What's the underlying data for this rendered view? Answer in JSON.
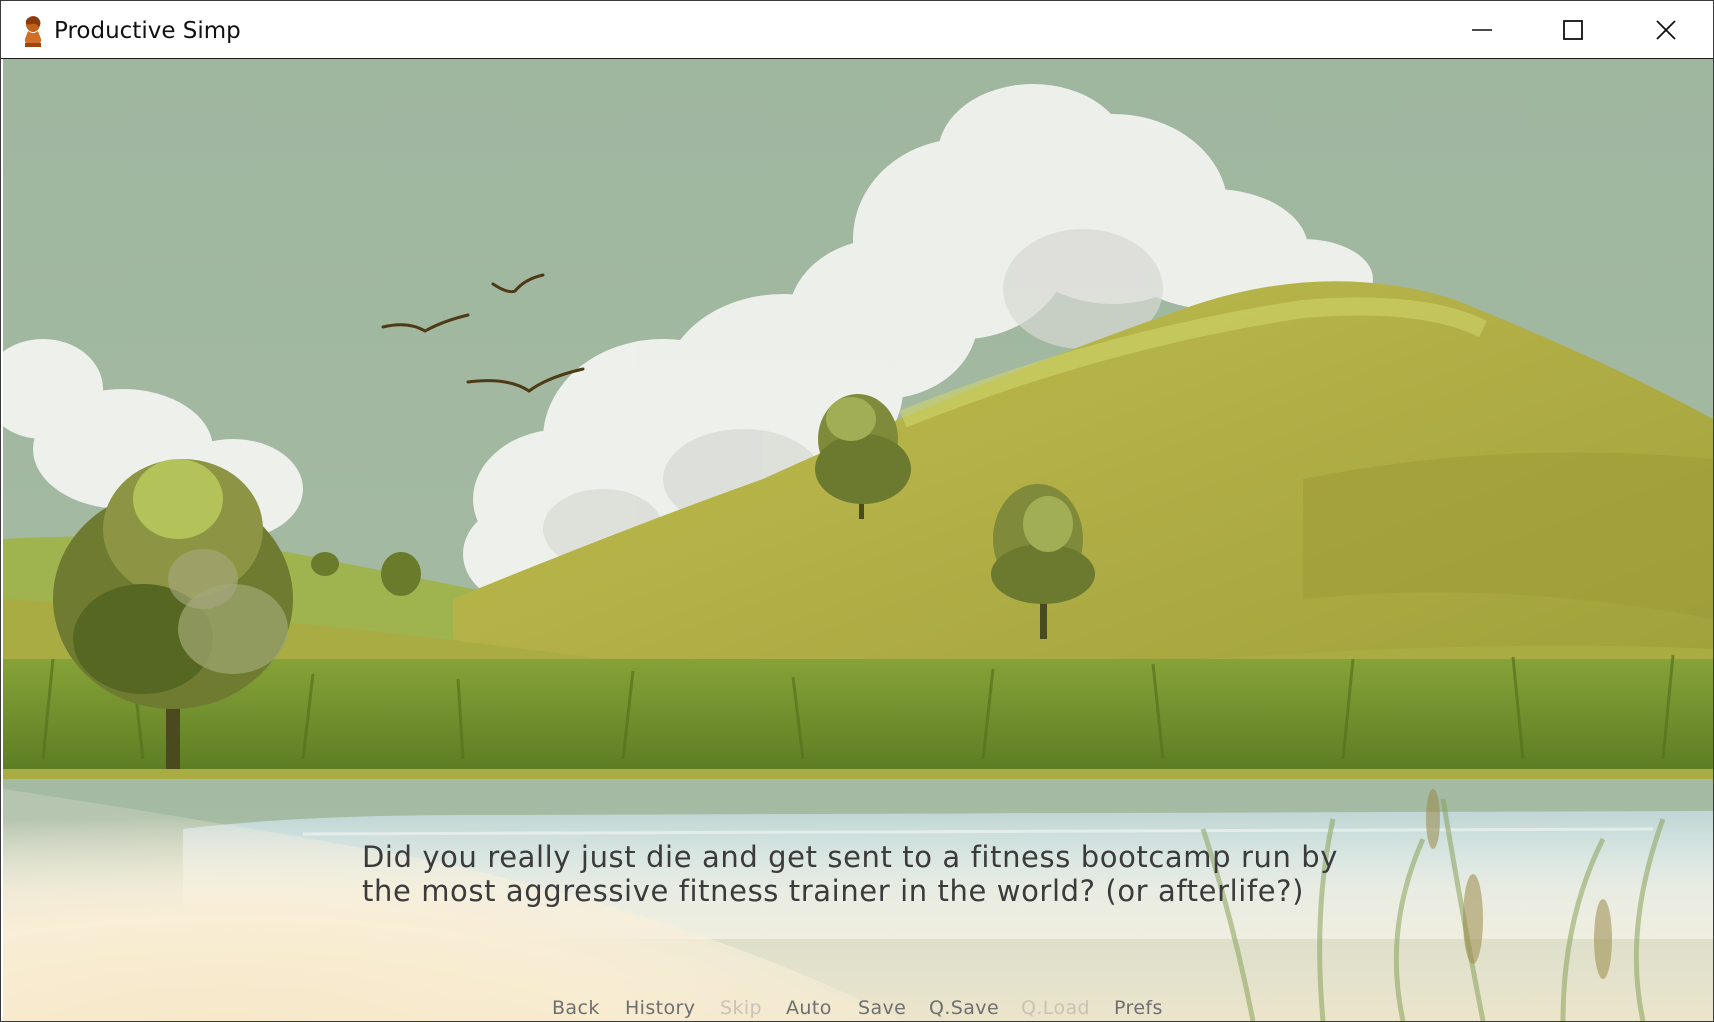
{
  "window": {
    "title": "Productive Simp",
    "icon": "bust-statue-icon",
    "controls": {
      "minimize": "minimize-icon",
      "maximize": "maximize-icon",
      "close": "close-icon"
    }
  },
  "dialogue": {
    "line1": "Did you really just die and get sent to a fitness bootcamp run by",
    "line2": "the most aggressive fitness trainer in the world? (or afterlife?)"
  },
  "quick_menu": {
    "back": "Back",
    "history": "History",
    "skip": "Skip",
    "auto": "Auto",
    "save": "Save",
    "qsave": "Q.Save",
    "qload": "Q.Load",
    "prefs": "Prefs"
  },
  "colors": {
    "sky": "#a1b8a1",
    "hill": "#b5b64a",
    "grass": "#6f8f2a",
    "water": "#c8dcdc",
    "sand": "#f2d9a8",
    "dialogue_text": "#3b3b3b",
    "menu_text": "#6f6f6f",
    "menu_disabled": "#c9c3b3"
  }
}
